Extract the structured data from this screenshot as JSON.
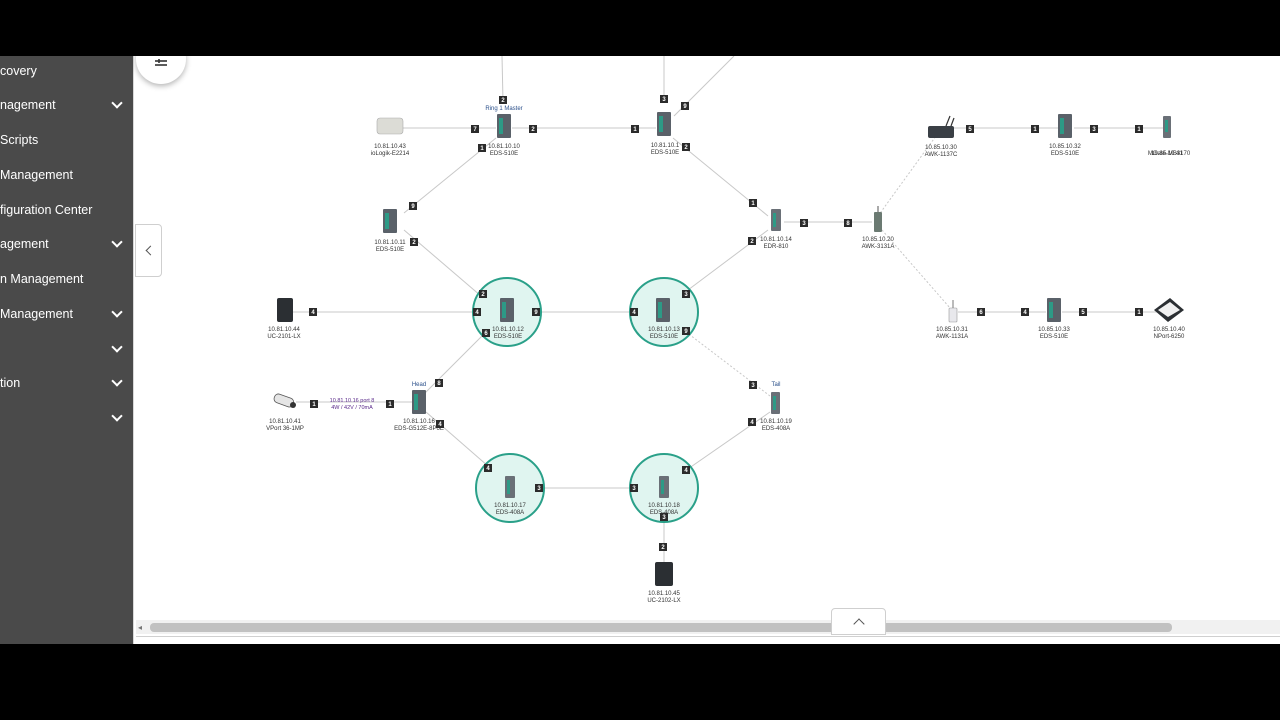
{
  "sidebar": {
    "items": [
      {
        "label": "covery",
        "chevron": false
      },
      {
        "label": "nagement",
        "chevron": true
      },
      {
        "label": "Scripts",
        "chevron": false
      },
      {
        "label": "Management",
        "chevron": false
      },
      {
        "label": "figuration Center",
        "chevron": false
      },
      {
        "label": "agement",
        "chevron": true
      },
      {
        "label": "n Management",
        "chevron": false
      },
      {
        "label": "Management",
        "chevron": true
      },
      {
        "label": "",
        "chevron": true
      },
      {
        "label": "tion",
        "chevron": true
      },
      {
        "label": "",
        "chevron": true
      }
    ]
  },
  "topology": {
    "ring_color": "#2aa089",
    "ring_fill": "#e0f5f0",
    "nodes": [
      {
        "id": "n1",
        "ip": "10.81.10.10",
        "model": "EDS-510E",
        "role": "Ring 1 Master",
        "icon": "switch-icon"
      },
      {
        "id": "n2",
        "ip": "10.81.10.1",
        "model": "EDS-510E",
        "icon": "switch-icon"
      },
      {
        "id": "n3",
        "ip": "10.81.10.43",
        "model": "ioLogik-E2214",
        "icon": "io-module-icon"
      },
      {
        "id": "n4",
        "ip": "10.81.10.11",
        "model": "EDS-510E",
        "icon": "switch-icon"
      },
      {
        "id": "n5",
        "ip": "10.81.10.14",
        "model": "EDR-810",
        "icon": "router-icon"
      },
      {
        "id": "n6",
        "ip": "10.85.10.20",
        "model": "AWK-3131A",
        "icon": "access-point-icon"
      },
      {
        "id": "n7",
        "ip": "10.85.10.30",
        "model": "AWK-1137C",
        "icon": "wireless-client-icon"
      },
      {
        "id": "n8",
        "ip": "10.85.10.32",
        "model": "EDS-510E",
        "icon": "switch-icon"
      },
      {
        "id": "n9",
        "ip": "10.85.10.41",
        "model": "MGate-MB3170",
        "icon": "gateway-icon"
      },
      {
        "id": "n10",
        "ip": "10.81.10.44",
        "model": "UC-2101-LX",
        "icon": "computer-icon"
      },
      {
        "id": "n11",
        "ip": "10.81.10.12",
        "model": "EDS-510E",
        "icon": "switch-icon",
        "ring": true
      },
      {
        "id": "n12",
        "ip": "10.81.10.13",
        "model": "EDS-510E",
        "icon": "switch-icon",
        "ring": true
      },
      {
        "id": "n13",
        "ip": "10.85.10.31",
        "model": "AWK-1131A",
        "icon": "access-point-icon"
      },
      {
        "id": "n14",
        "ip": "10.85.10.33",
        "model": "EDS-510E",
        "icon": "switch-icon"
      },
      {
        "id": "n15",
        "ip": "10.85.10.40",
        "model": "NPort-6250",
        "icon": "serial-server-icon"
      },
      {
        "id": "n16",
        "ip": "10.81.10.41",
        "model": "VPort 36-1MP",
        "icon": "camera-icon"
      },
      {
        "id": "n17",
        "ip": "10.81.10.16",
        "model": "EDS-G512E-8PoE",
        "role": "Head",
        "icon": "switch-icon"
      },
      {
        "id": "n18",
        "ip": "10.81.10.19",
        "model": "EDS-408A",
        "role": "Tail",
        "icon": "switch-icon"
      },
      {
        "id": "n19",
        "ip": "10.81.10.17",
        "model": "EDS-408A",
        "icon": "switch-icon",
        "ring": true
      },
      {
        "id": "n20",
        "ip": "10.81.10.18",
        "model": "EDS-408A",
        "icon": "switch-icon",
        "ring": true
      },
      {
        "id": "n21",
        "ip": "10.81.10.45",
        "model": "UC-2102-LX",
        "icon": "computer-icon"
      }
    ],
    "poe_info": {
      "line1": "10.81.10.16 port 8",
      "line2": "4W / 42V / 70mA"
    },
    "ports": [
      "2",
      "7",
      "2",
      "1",
      "3",
      "9",
      "2",
      "1",
      "5",
      "1",
      "3",
      "1",
      "9",
      "2",
      "1",
      "2",
      "3",
      "8",
      "2",
      "4",
      "9",
      "6",
      "4",
      "3",
      "9",
      "6",
      "4",
      "5",
      "1",
      "4",
      "1",
      "1",
      "8",
      "4",
      "3",
      "4",
      "4",
      "3",
      "3",
      "4",
      "3",
      "2",
      "6",
      "2"
    ]
  }
}
